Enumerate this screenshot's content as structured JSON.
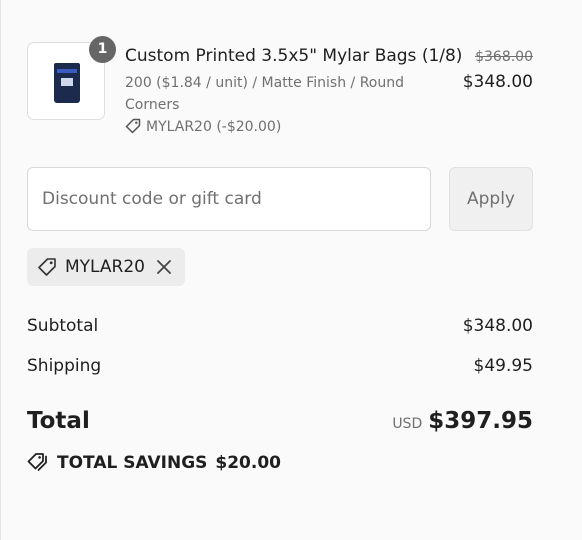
{
  "line_item": {
    "quantity": "1",
    "title": "Custom Printed 3.5x5\" Mylar Bags (1/8)",
    "description": "200 ($1.84 / unit) / Matte Finish / Round Corners",
    "discount": "MYLAR20 (-$20.00)",
    "compare_price": "$368.00",
    "price": "$348.00"
  },
  "discount_form": {
    "placeholder": "Discount code or gift card",
    "value": "",
    "apply_label": "Apply"
  },
  "applied_code": {
    "label": "MYLAR20"
  },
  "summary": {
    "subtotal_label": "Subtotal",
    "subtotal_value": "$348.00",
    "shipping_label": "Shipping",
    "shipping_value": "$49.95",
    "total_label": "Total",
    "currency": "USD",
    "total_value": "$397.95",
    "savings_label": "TOTAL SAVINGS",
    "savings_value": "$20.00"
  },
  "icons": {
    "product_thumbnail": "mylar-bag-image",
    "quantity_badge": "count-badge",
    "discount_tag": "tag-icon",
    "remove_code": "close-icon",
    "savings": "tags-icon"
  },
  "colors": {
    "background": "#fafafa",
    "text": "#1f1f1f",
    "muted": "#707070",
    "badge": "#666666"
  }
}
